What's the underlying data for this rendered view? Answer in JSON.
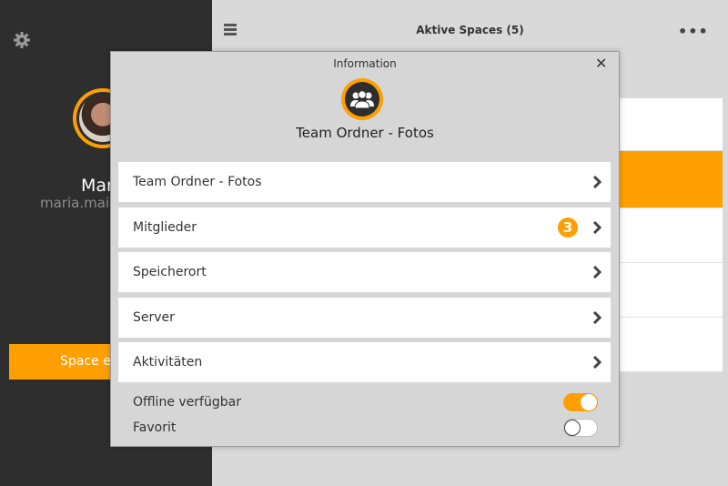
{
  "sidebar": {
    "user_name": "Mar",
    "user_email": "maria.mail",
    "create_space_label": "Space er",
    "icons": {
      "settings": "gear-icon",
      "avatar": "avatar"
    }
  },
  "header": {
    "title": "Aktive Spaces (5)",
    "menu_icon": "hamburger-icon",
    "more_icon": "more-icon"
  },
  "modal": {
    "title": "Information",
    "close_label": "✕",
    "folder_name": "Team Ordner - Fotos",
    "rows": [
      {
        "label": "Team Ordner - Fotos"
      },
      {
        "label": "Mitglieder",
        "badge": "3"
      },
      {
        "label": "Speicherort"
      },
      {
        "label": "Server"
      },
      {
        "label": "Aktivitäten"
      }
    ],
    "toggles": [
      {
        "label": "Offline verfügbar",
        "state": "on"
      },
      {
        "label": "Favorit",
        "state": "off"
      }
    ]
  },
  "colors": {
    "accent": "#ff9f00",
    "sidebar_bg": "#2e2e2e",
    "panel_bg": "#d9d9d9"
  }
}
